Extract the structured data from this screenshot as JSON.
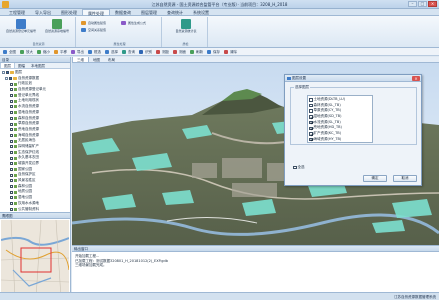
{
  "window": {
    "title": "江苏自然资源 - 国土资源综合监管平台（专业版）· 当前项目：3208_H_2018",
    "min": "–",
    "max": "□",
    "close": "×"
  },
  "menu": {
    "tabs": [
      "工程管理",
      "导入导出",
      "图形处理",
      "属性处理",
      "数据查询",
      "图层管理",
      "查询统计",
      "系统设置"
    ],
    "active_index": 3
  },
  "ribbon": {
    "groups": [
      {
        "label": "自然资源",
        "buttons": [
          "自然资源登记单元编号",
          "自然资源宗地编号"
        ]
      },
      {
        "label": "属性处理",
        "small": [
          "自动属性赋值",
          "空间关系赋值",
          "属性生成公式"
        ]
      },
      {
        "label": "质检",
        "buttons": [
          "自然资源统计表"
        ]
      }
    ]
  },
  "maptools": [
    "全图",
    "放大",
    "缩小",
    "平移",
    "导出",
    "框选",
    "选择",
    "查询",
    "识别",
    "测距",
    "测面",
    "刷新",
    "保存",
    "清除"
  ],
  "left_panel": {
    "title": "目录",
    "tabs": [
      "图层",
      "图幅",
      "本地图层"
    ],
    "root": "图层",
    "group": "自然资源数据",
    "layers": [
      "行政区划",
      "自然资源登记单元",
      "登记单元界线",
      "土地利用现状",
      "水流自然资源",
      "湿地自然资源",
      "森林自然资源",
      "草原自然资源",
      "荒地自然资源",
      "海域自然资源",
      "无居民海岛",
      "探明储量矿产",
      "生态保护红线",
      "永久基本农田",
      "城镇开发边界",
      "国家公园",
      "自然保护区",
      "风景名胜区",
      "森林公园",
      "地质公园",
      "湿地公园",
      "饮用水水源地",
      "公共管制资料",
      "自然资源调查"
    ]
  },
  "overview": {
    "title": "鹰眼图"
  },
  "map": {
    "tabs": [
      "三维",
      "地图",
      "布局"
    ],
    "active_index": 0
  },
  "dialog": {
    "title": "图层设置",
    "group_label": "选择图层",
    "items": [
      {
        "label": "土地资源(DLTB_LU)",
        "checked": false
      },
      {
        "label": "森林资源(SL_TB)",
        "checked": false
      },
      {
        "label": "草原资源(CY_TB)",
        "checked": false
      },
      {
        "label": "湿地资源(SD_TB)",
        "checked": true
      },
      {
        "label": "水流资源(SL_TB)",
        "checked": true
      },
      {
        "label": "荒地资源(HD_TB)",
        "checked": true
      },
      {
        "label": "矿产资源(KC_TB)",
        "checked": true
      },
      {
        "label": "海域资源(HY_TB)",
        "checked": true
      }
    ],
    "select_all": "全选",
    "ok": "确定",
    "cancel": "取消"
  },
  "output": {
    "title": "输出窗口",
    "lines": [
      "开始加载工程...",
      "已加载工程：测试数据320801_H_20181012(2)_EXP.gdb",
      "三维场景加载完成。"
    ]
  },
  "status": {
    "right": "江苏自然资源数据管理系统"
  }
}
